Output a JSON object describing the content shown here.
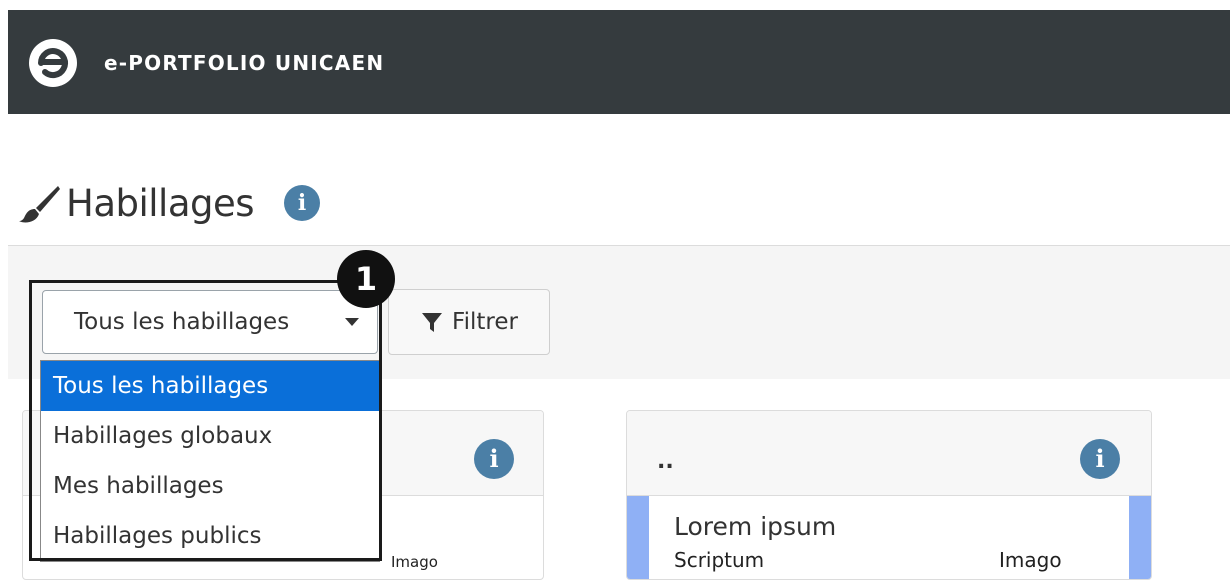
{
  "header": {
    "brand": "e-PORTFOLIO UNICAEN",
    "logo_icon": "e-logo-icon"
  },
  "page": {
    "title": "Habillages",
    "title_icon": "paint-brush-icon",
    "info_icon": "info-icon",
    "info_glyph": "i"
  },
  "toolbar": {
    "select_value": "Tous les habillages",
    "filter_label": "Filtrer",
    "filter_icon": "funnel-icon"
  },
  "dropdown": {
    "options": [
      "Tous les habillages",
      "Habillages globaux",
      "Mes habillages",
      "Habillages publics"
    ],
    "selected_index": 0
  },
  "callout": {
    "number": "1"
  },
  "cards": [
    {
      "title": "",
      "preview_left": "",
      "preview_right": "Imago"
    },
    {
      "title": "..",
      "preview_heading": "Lorem ipsum",
      "preview_left": "Scriptum",
      "preview_right": "Imago"
    }
  ],
  "colors": {
    "topbar": "#353b3e",
    "selected_option": "#0a6fd9",
    "info_badge": "#4b7fa6",
    "preview_accent": "#8fb0f5"
  }
}
